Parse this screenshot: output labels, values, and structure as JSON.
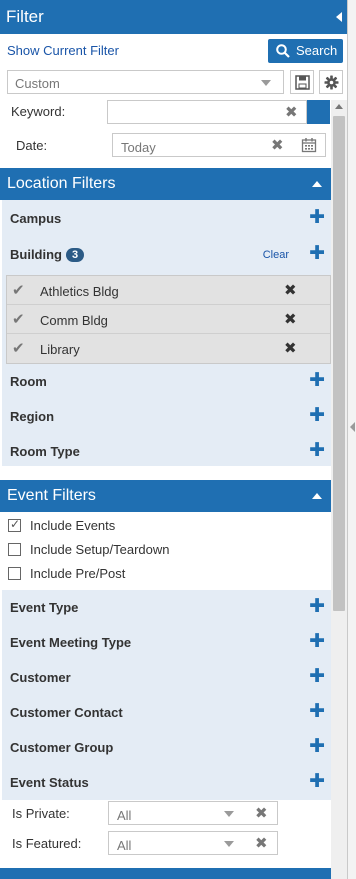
{
  "header": {
    "title": "Filter"
  },
  "top": {
    "show_filter_label": "Show Current Filter",
    "search_label": "Search",
    "preset_value": "Custom"
  },
  "fields": {
    "keyword_label": "Keyword:",
    "keyword_value": "",
    "date_label": "Date:",
    "date_value": "Today"
  },
  "location": {
    "title": "Location Filters",
    "campus": "Campus",
    "building": "Building",
    "building_count": "3",
    "clear_label": "Clear",
    "buildings": [
      "Athletics Bldg",
      "Comm Bldg",
      "Library"
    ],
    "room": "Room",
    "region": "Region",
    "room_type": "Room Type"
  },
  "event": {
    "title": "Event Filters",
    "checkboxes": [
      {
        "label": "Include Events",
        "checked": true
      },
      {
        "label": "Include Setup/Teardown",
        "checked": false
      },
      {
        "label": "Include Pre/Post",
        "checked": false
      }
    ],
    "rows": [
      "Event Type",
      "Event Meeting Type",
      "Customer",
      "Customer Contact",
      "Customer Group",
      "Event Status"
    ],
    "is_private_label": "Is Private:",
    "is_private_value": "All",
    "is_featured_label": "Is Featured:",
    "is_featured_value": "All"
  },
  "colors": {
    "accent": "#1f6fb2",
    "section_bg": "#e4ecf5",
    "selected_bg": "#e2e2e2"
  }
}
